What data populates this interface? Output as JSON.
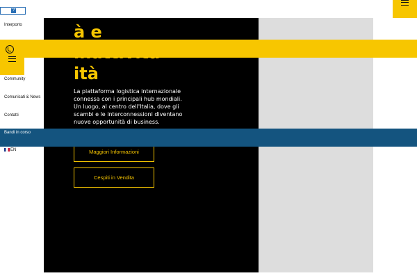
{
  "header": {
    "logo_glyph": "?"
  },
  "nav": {
    "items": [
      {
        "label": "Interporto"
      },
      {
        "label": "Community"
      },
      {
        "label": "Comunicati & News"
      },
      {
        "label": "Contatti"
      }
    ],
    "highlighted": {
      "label": "Bandi in corso"
    },
    "language": {
      "label": "EN"
    }
  },
  "hero": {
    "title_lines": [
      "à e",
      "inattività",
      "ità"
    ],
    "description": "La piattaforma logistica internazionale connessa con i principali hub mondiali. Un luogo, al centro dell'Italia, dove gli scambi e le interconnessioni diventano nuove opportunità di business.",
    "buttons": [
      {
        "label": "Maggiori Informazioni"
      },
      {
        "label": "Cespiti in Vendita"
      }
    ]
  },
  "icons": {
    "phone": "phone-icon",
    "menu": "hamburger-menu-icon"
  },
  "colors": {
    "accent": "#f7c600",
    "hero_bg": "#000000",
    "bar_blue": "#14547f",
    "panel_grey": "#dddddd"
  }
}
